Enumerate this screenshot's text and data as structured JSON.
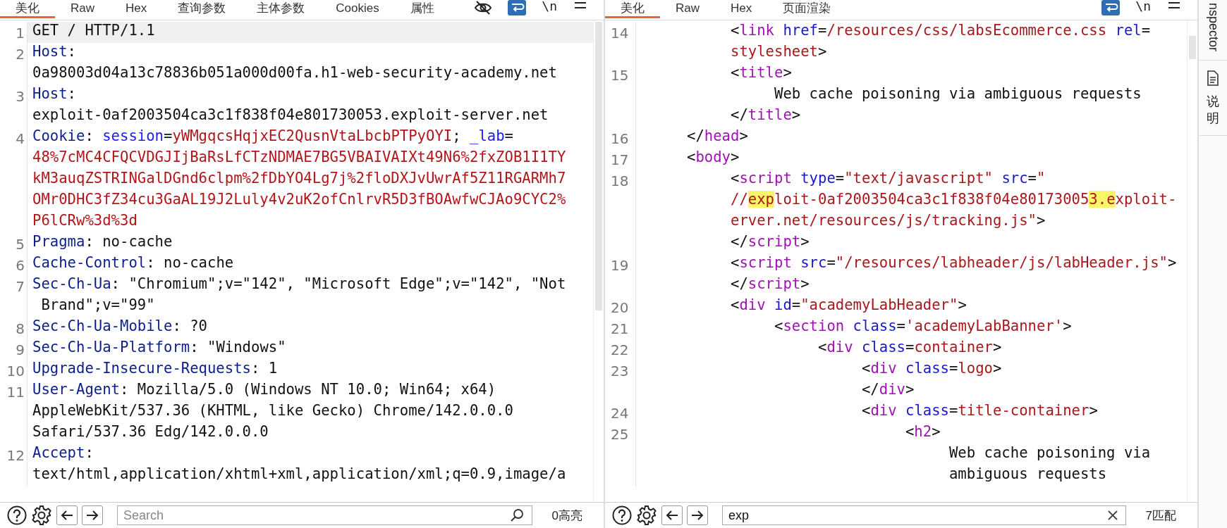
{
  "left": {
    "tabs": [
      {
        "label": "美化",
        "selected": true
      },
      {
        "label": "Raw",
        "selected": false
      },
      {
        "label": "Hex",
        "selected": false
      },
      {
        "label": "查询参数",
        "selected": false
      },
      {
        "label": "主体参数",
        "selected": false
      },
      {
        "label": "Cookies",
        "selected": false
      },
      {
        "label": "属性",
        "selected": false
      }
    ],
    "toolbar": {
      "hide_icon": true,
      "wrap_on": true,
      "newline_label": "\\n"
    },
    "lines": [
      {
        "number": "1",
        "current": true,
        "rows": [
          {
            "tokens": [
              {
                "kind": "plain",
                "text": "GET / HTTP/1.1"
              }
            ]
          }
        ]
      },
      {
        "number": "2",
        "current": false,
        "rows": [
          {
            "tokens": [
              {
                "kind": "name",
                "text": "Host"
              },
              {
                "kind": "plain",
                "text": ":"
              }
            ]
          },
          {
            "tokens": [
              {
                "kind": "plain",
                "text": "0a98003d04a13c78836b051a000d00fa.h1-web-security-academy.net"
              }
            ]
          }
        ]
      },
      {
        "number": "3",
        "current": false,
        "rows": [
          {
            "tokens": [
              {
                "kind": "name",
                "text": "Host"
              },
              {
                "kind": "plain",
                "text": ":"
              }
            ]
          },
          {
            "tokens": [
              {
                "kind": "plain",
                "text": "exploit-0af2003504ca3c1f838f04e801730053.exploit-server.net"
              }
            ]
          }
        ]
      },
      {
        "number": "4",
        "current": false,
        "rows": [
          {
            "tokens": [
              {
                "kind": "name",
                "text": "Cookie"
              },
              {
                "kind": "plain",
                "text": ": "
              },
              {
                "kind": "key",
                "text": "session"
              },
              {
                "kind": "plain",
                "text": "="
              },
              {
                "kind": "value",
                "text": "yWMgqcsHqjxEC2QusnVtaLbcbPTPyOYI"
              },
              {
                "kind": "plain",
                "text": "; "
              },
              {
                "kind": "key",
                "text": "_lab"
              },
              {
                "kind": "plain",
                "text": "="
              }
            ]
          },
          {
            "tokens": [
              {
                "kind": "value",
                "text": "48%7cMC4CFQCVDGJIjBaRsLfCTzNDMAE7BG5VBAIVAIXt49N6%2fxZOB1I1TY"
              }
            ]
          },
          {
            "tokens": [
              {
                "kind": "value",
                "text": "kM3auqZSTRINGalDGnd6clpm%2fDbYO4Lg7j%2floDXJvUwrAf5Z11RGARMh7"
              }
            ]
          },
          {
            "tokens": [
              {
                "kind": "value",
                "text": "OMr0DHC3fZ34cu3GaAL19J2Luly4v2uK2ofCnlrvR5D3fBOAwfwCJAo9CYC2%"
              }
            ]
          },
          {
            "tokens": [
              {
                "kind": "value",
                "text": "P6lCRw%3d%3d"
              }
            ]
          }
        ]
      },
      {
        "number": "5",
        "current": false,
        "rows": [
          {
            "tokens": [
              {
                "kind": "name",
                "text": "Pragma"
              },
              {
                "kind": "plain",
                "text": ": no-cache"
              }
            ]
          }
        ]
      },
      {
        "number": "6",
        "current": false,
        "rows": [
          {
            "tokens": [
              {
                "kind": "name",
                "text": "Cache-Control"
              },
              {
                "kind": "plain",
                "text": ": no-cache"
              }
            ]
          }
        ]
      },
      {
        "number": "7",
        "current": false,
        "rows": [
          {
            "tokens": [
              {
                "kind": "name",
                "text": "Sec-Ch-Ua"
              },
              {
                "kind": "plain",
                "text": ": \"Chromium\";v=\"142\", \"Microsoft Edge\";v=\"142\", \"Not"
              }
            ]
          },
          {
            "tokens": [
              {
                "kind": "plain",
                "text": " Brand\";v=\"99\""
              }
            ]
          }
        ]
      },
      {
        "number": "8",
        "current": false,
        "rows": [
          {
            "tokens": [
              {
                "kind": "name",
                "text": "Sec-Ch-Ua-Mobile"
              },
              {
                "kind": "plain",
                "text": ": ?0"
              }
            ]
          }
        ]
      },
      {
        "number": "9",
        "current": false,
        "rows": [
          {
            "tokens": [
              {
                "kind": "name",
                "text": "Sec-Ch-Ua-Platform"
              },
              {
                "kind": "plain",
                "text": ": \"Windows\""
              }
            ]
          }
        ]
      },
      {
        "number": "10",
        "current": false,
        "rows": [
          {
            "tokens": [
              {
                "kind": "name",
                "text": "Upgrade-Insecure-Requests"
              },
              {
                "kind": "plain",
                "text": ": 1"
              }
            ]
          }
        ]
      },
      {
        "number": "11",
        "current": false,
        "rows": [
          {
            "tokens": [
              {
                "kind": "name",
                "text": "User-Agent"
              },
              {
                "kind": "plain",
                "text": ": Mozilla/5.0 (Windows NT 10.0; Win64; x64)"
              }
            ]
          },
          {
            "tokens": [
              {
                "kind": "plain",
                "text": "AppleWebKit/537.36 (KHTML, like Gecko) Chrome/142.0.0.0"
              }
            ]
          },
          {
            "tokens": [
              {
                "kind": "plain",
                "text": "Safari/537.36 Edg/142.0.0.0"
              }
            ]
          }
        ]
      },
      {
        "number": "12",
        "current": false,
        "rows": [
          {
            "tokens": [
              {
                "kind": "name",
                "text": "Accept"
              },
              {
                "kind": "plain",
                "text": ":"
              }
            ]
          },
          {
            "tokens": [
              {
                "kind": "plain",
                "text": "text/html,application/xhtml+xml,application/xml;q=0.9,image/a"
              }
            ]
          }
        ]
      }
    ],
    "search": {
      "placeholder": "Search",
      "count": "0高亮"
    }
  },
  "right": {
    "tabs": [
      {
        "label": "美化",
        "selected": true
      },
      {
        "label": "Raw",
        "selected": false
      },
      {
        "label": "Hex",
        "selected": false
      },
      {
        "label": "页面渲染",
        "selected": false
      }
    ],
    "toolbar": {
      "wrap_on": true,
      "newline_label": "\\n"
    },
    "lines": [
      {
        "number": "14",
        "current": false,
        "rows": [
          {
            "tokens": [
              {
                "kind": "plain",
                "text": "          <"
              },
              {
                "kind": "tag",
                "text": "link"
              },
              {
                "kind": "attr",
                "text": " href"
              },
              {
                "kind": "plain",
                "text": "="
              },
              {
                "kind": "string",
                "text": "/resources/css/labsEcommerce.css"
              },
              {
                "kind": "attr",
                "text": " rel"
              },
              {
                "kind": "plain",
                "text": "="
              }
            ]
          },
          {
            "tokens": [
              {
                "kind": "string",
                "text": "          stylesheet"
              },
              {
                "kind": "plain",
                "text": ">"
              }
            ]
          }
        ]
      },
      {
        "number": "15",
        "current": false,
        "rows": [
          {
            "tokens": [
              {
                "kind": "plain",
                "text": "          <"
              },
              {
                "kind": "tag",
                "text": "title"
              },
              {
                "kind": "plain",
                "text": ">"
              }
            ]
          },
          {
            "tokens": [
              {
                "kind": "plain",
                "text": "               Web cache poisoning via ambiguous requests"
              }
            ]
          },
          {
            "tokens": [
              {
                "kind": "plain",
                "text": "          </"
              },
              {
                "kind": "tag",
                "text": "title"
              },
              {
                "kind": "plain",
                "text": ">"
              }
            ]
          }
        ]
      },
      {
        "number": "16",
        "current": false,
        "rows": [
          {
            "tokens": [
              {
                "kind": "plain",
                "text": "     </"
              },
              {
                "kind": "tag",
                "text": "head"
              },
              {
                "kind": "plain",
                "text": ">"
              }
            ]
          }
        ]
      },
      {
        "number": "17",
        "current": false,
        "rows": [
          {
            "tokens": [
              {
                "kind": "plain",
                "text": "     <"
              },
              {
                "kind": "tag",
                "text": "body"
              },
              {
                "kind": "plain",
                "text": ">"
              }
            ]
          }
        ]
      },
      {
        "number": "18",
        "current": false,
        "rows": [
          {
            "tokens": [
              {
                "kind": "plain",
                "text": "          <"
              },
              {
                "kind": "tag",
                "text": "script"
              },
              {
                "kind": "attr",
                "text": " type"
              },
              {
                "kind": "plain",
                "text": "="
              },
              {
                "kind": "string",
                "text": "\"text/javascript\""
              },
              {
                "kind": "attr",
                "text": " src"
              },
              {
                "kind": "plain",
                "text": "="
              },
              {
                "kind": "string",
                "text": "\""
              }
            ]
          },
          {
            "tokens": [
              {
                "kind": "string",
                "text": "          //"
              },
              {
                "kind": "match",
                "text": "exp"
              },
              {
                "kind": "string",
                "text": "loit-0af2003504ca3c1f838f04e80173005"
              },
              {
                "kind": "match",
                "text": "3.e"
              },
              {
                "kind": "string",
                "text": "xploit-"
              }
            ]
          },
          {
            "tokens": [
              {
                "kind": "string",
                "text": "          erver.net/resources/js/tracking.js\""
              },
              {
                "kind": "plain",
                "text": ">"
              }
            ]
          },
          {
            "tokens": [
              {
                "kind": "plain",
                "text": "          </"
              },
              {
                "kind": "tag",
                "text": "script"
              },
              {
                "kind": "plain",
                "text": ">"
              }
            ]
          }
        ]
      },
      {
        "number": "19",
        "current": false,
        "rows": [
          {
            "tokens": [
              {
                "kind": "plain",
                "text": "          <"
              },
              {
                "kind": "tag",
                "text": "script"
              },
              {
                "kind": "attr",
                "text": " src"
              },
              {
                "kind": "plain",
                "text": "="
              },
              {
                "kind": "string",
                "text": "\"/resources/labheader/js/labHeader.js\""
              },
              {
                "kind": "plain",
                "text": ">"
              }
            ]
          },
          {
            "tokens": [
              {
                "kind": "plain",
                "text": "          </"
              },
              {
                "kind": "tag",
                "text": "script"
              },
              {
                "kind": "plain",
                "text": ">"
              }
            ]
          }
        ]
      },
      {
        "number": "20",
        "current": false,
        "rows": [
          {
            "tokens": [
              {
                "kind": "plain",
                "text": "          <"
              },
              {
                "kind": "tag",
                "text": "div"
              },
              {
                "kind": "attr",
                "text": " id"
              },
              {
                "kind": "plain",
                "text": "="
              },
              {
                "kind": "string",
                "text": "\"academyLabHeader\""
              },
              {
                "kind": "plain",
                "text": ">"
              }
            ]
          }
        ]
      },
      {
        "number": "21",
        "current": false,
        "rows": [
          {
            "tokens": [
              {
                "kind": "plain",
                "text": "               <"
              },
              {
                "kind": "tag",
                "text": "section"
              },
              {
                "kind": "attr",
                "text": " class"
              },
              {
                "kind": "plain",
                "text": "="
              },
              {
                "kind": "string",
                "text": "'academyLabBanner'"
              },
              {
                "kind": "plain",
                "text": ">"
              }
            ]
          }
        ]
      },
      {
        "number": "22",
        "current": false,
        "rows": [
          {
            "tokens": [
              {
                "kind": "plain",
                "text": "                    <"
              },
              {
                "kind": "tag",
                "text": "div"
              },
              {
                "kind": "attr",
                "text": " class"
              },
              {
                "kind": "plain",
                "text": "="
              },
              {
                "kind": "string",
                "text": "container"
              },
              {
                "kind": "plain",
                "text": ">"
              }
            ]
          }
        ]
      },
      {
        "number": "23",
        "current": false,
        "rows": [
          {
            "tokens": [
              {
                "kind": "plain",
                "text": "                         <"
              },
              {
                "kind": "tag",
                "text": "div"
              },
              {
                "kind": "attr",
                "text": " class"
              },
              {
                "kind": "plain",
                "text": "="
              },
              {
                "kind": "string",
                "text": "logo"
              },
              {
                "kind": "plain",
                "text": ">"
              }
            ]
          },
          {
            "tokens": [
              {
                "kind": "plain",
                "text": "                         </"
              },
              {
                "kind": "tag",
                "text": "div"
              },
              {
                "kind": "plain",
                "text": ">"
              }
            ]
          }
        ]
      },
      {
        "number": "24",
        "current": false,
        "rows": [
          {
            "tokens": [
              {
                "kind": "plain",
                "text": "                         <"
              },
              {
                "kind": "tag",
                "text": "div"
              },
              {
                "kind": "attr",
                "text": " class"
              },
              {
                "kind": "plain",
                "text": "="
              },
              {
                "kind": "string",
                "text": "title-container"
              },
              {
                "kind": "plain",
                "text": ">"
              }
            ]
          }
        ]
      },
      {
        "number": "25",
        "current": false,
        "rows": [
          {
            "tokens": [
              {
                "kind": "plain",
                "text": "                              <"
              },
              {
                "kind": "tag",
                "text": "h2"
              },
              {
                "kind": "plain",
                "text": ">"
              }
            ]
          },
          {
            "tokens": [
              {
                "kind": "plain",
                "text": "                                   Web cache poisoning via"
              }
            ]
          },
          {
            "tokens": [
              {
                "kind": "plain",
                "text": "                                   ambiguous requests"
              }
            ]
          }
        ]
      }
    ],
    "search": {
      "value": "exp",
      "count": "7匹配"
    }
  },
  "sidebar": {
    "items": [
      {
        "kind": "latin",
        "label": "nspector"
      },
      {
        "kind": "cjk",
        "label": "说明"
      }
    ]
  }
}
